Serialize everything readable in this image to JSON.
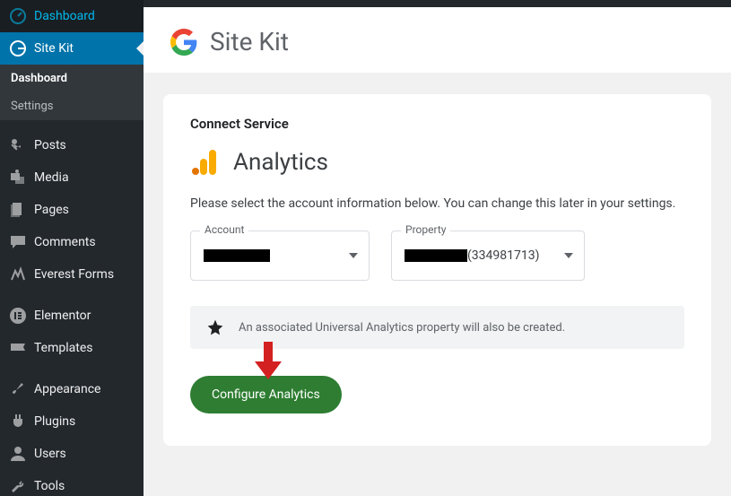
{
  "sidebar": {
    "top": [
      {
        "label": "Dashboard",
        "icon": "dashboard"
      },
      {
        "label": "Site Kit",
        "icon": "google-g",
        "active": true
      }
    ],
    "submenu": [
      {
        "label": "Dashboard",
        "current": true
      },
      {
        "label": "Settings",
        "current": false
      }
    ],
    "groups": [
      [
        {
          "label": "Posts",
          "icon": "pin"
        },
        {
          "label": "Media",
          "icon": "media"
        },
        {
          "label": "Pages",
          "icon": "page"
        },
        {
          "label": "Comments",
          "icon": "comment"
        },
        {
          "label": "Everest Forms",
          "icon": "forms"
        }
      ],
      [
        {
          "label": "Elementor",
          "icon": "elementor"
        },
        {
          "label": "Templates",
          "icon": "templates"
        }
      ],
      [
        {
          "label": "Appearance",
          "icon": "brush"
        },
        {
          "label": "Plugins",
          "icon": "plug"
        },
        {
          "label": "Users",
          "icon": "user"
        },
        {
          "label": "Tools",
          "icon": "wrench"
        }
      ]
    ]
  },
  "header": {
    "title": "Site Kit"
  },
  "card": {
    "title": "Connect Service",
    "service": "Analytics",
    "desc": "Please select the account information below. You can change this later in your settings.",
    "account": {
      "legend": "Account"
    },
    "property": {
      "legend": "Property",
      "suffix": "(334981713)"
    },
    "notice": "An associated Universal Analytics property will also be created.",
    "cta": "Configure Analytics"
  }
}
